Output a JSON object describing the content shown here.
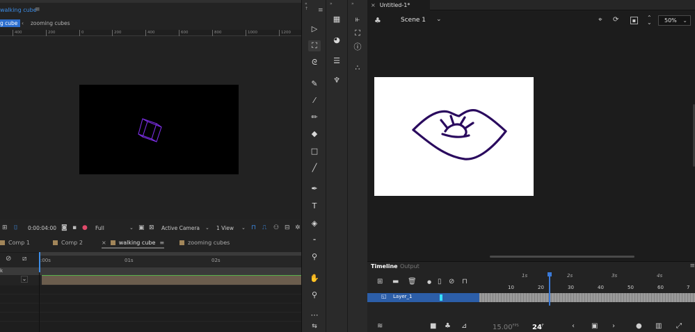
{
  "after_effects": {
    "panel_title": "walking cube",
    "breadcrumbs": [
      "g cube",
      "zooming cubes"
    ],
    "ruler_ticks": [
      "400",
      "200",
      "0",
      "200",
      "400",
      "600",
      "800",
      "1000",
      "1200"
    ],
    "viewer": {
      "timecode": "0:00:04:00",
      "resolution": "Full",
      "camera": "Active Camera",
      "views": "1 View"
    },
    "timeline_tabs": [
      {
        "label": "Comp 1",
        "color": "#a2865a"
      },
      {
        "label": "Comp 2",
        "color": "#a2865a"
      },
      {
        "label": "walking cube",
        "color": "#a2865a"
      },
      {
        "label": "zooming cubes",
        "color": "#a2865a"
      }
    ],
    "time_labels": [
      ":00s",
      "01s",
      "02s"
    ],
    "layer_label": "k"
  },
  "animate": {
    "document_tab": "Untitled-1*",
    "scene": "Scene 1",
    "zoom": "50%",
    "timeline": {
      "tabs": [
        "Timeline",
        "Output"
      ],
      "second_labels": [
        "1s",
        "2s",
        "3s",
        "4s"
      ],
      "frame_numbers": [
        "10",
        "20",
        "30",
        "40",
        "50",
        "60",
        "7"
      ],
      "layer_name": "Layer_1",
      "fps": "15.00",
      "fps_unit": "FPS",
      "current_frame": "24",
      "frame_unit": "F"
    }
  }
}
